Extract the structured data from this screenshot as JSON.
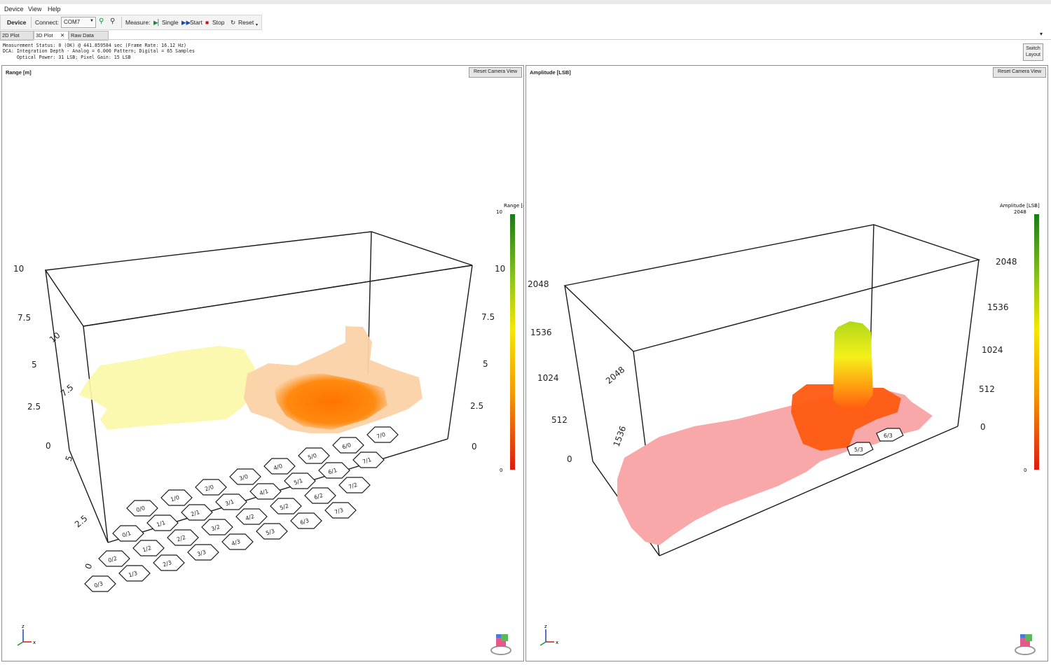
{
  "menu": [
    "Device",
    "View",
    "Help"
  ],
  "toolbar": {
    "device": "Device",
    "connect": "Connect:",
    "port": "COM7",
    "measure": "Measure:",
    "single": "Single",
    "start": "Start",
    "stop": "Stop",
    "reset": "Reset"
  },
  "tabs": [
    {
      "label": "2D Plot",
      "active": false
    },
    {
      "label": "3D Plot",
      "active": true,
      "close": "✕"
    },
    {
      "label": "Raw Data",
      "active": false
    }
  ],
  "status_lines": [
    "Measurement Status: 0 (OK) @ 441.859584 sec (Frame Rate: 16.12 Hz)",
    "DCA: Integration Depth - Analog = 6.000 Pattern; Digital = 65 Samples",
    "     Optical Power: 31 LSB; Pixel Gain: 15 LSB"
  ],
  "switch_layout": [
    "Switch",
    "Layout"
  ],
  "panels": [
    {
      "title": "Range [m]",
      "reset_label": "Reset Camera View",
      "colorbar_title": "Range [m]",
      "colorbar_max": "10",
      "colorbar_min": "0",
      "z_ticks_left": [
        "10",
        "7.5",
        "5",
        "2.5",
        "0"
      ],
      "z_ticks_right": [
        "10",
        "7.5",
        "5",
        "2.5",
        "0"
      ],
      "y_ticks": [
        "10",
        "7.5",
        "5",
        "2.5",
        "0"
      ],
      "cells": [
        "0/0",
        "1/0",
        "2/0",
        "3/0",
        "4/0",
        "5/0",
        "6/0",
        "7/0",
        "0/1",
        "1/1",
        "2/1",
        "3/1",
        "4/1",
        "5/1",
        "6/1",
        "7/1",
        "0/2",
        "1/2",
        "2/2",
        "3/2",
        "4/2",
        "5/2",
        "6/2",
        "7/2",
        "0/3",
        "1/3",
        "2/3",
        "3/3",
        "4/3",
        "5/3",
        "6/3",
        "7/3"
      ],
      "axis_x": "x",
      "axis_z": "z"
    },
    {
      "title": "Amplitude [LSB]",
      "reset_label": "Reset Camera View",
      "colorbar_title": "Amplitude [LSB]",
      "colorbar_max": "2048",
      "colorbar_min": "0",
      "z_ticks_left": [
        "2048",
        "1536",
        "1024",
        "512",
        "0"
      ],
      "z_ticks_right": [
        "2048",
        "1536",
        "1024",
        "512",
        "0"
      ],
      "y_ticks": [
        "2048",
        "1536"
      ],
      "cells": [
        "5/3",
        "6/3"
      ],
      "axis_x": "x",
      "axis_z": "z"
    }
  ],
  "colors": {
    "colorbar_top": "#1a7a1a",
    "colorbar_mid": "#f5e800",
    "colorbar_bottom": "#e01a10",
    "range_far": "#fbf7a8",
    "range_near": "#ff7a00",
    "amplitude_base": "#f8a8a8"
  }
}
